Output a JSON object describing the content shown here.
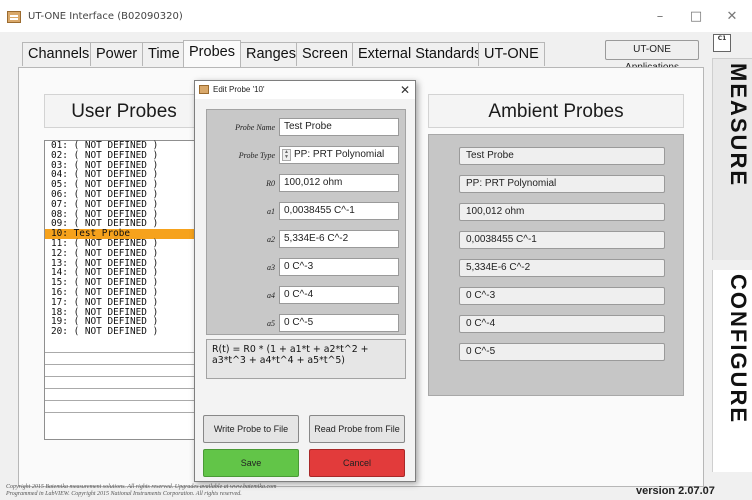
{
  "window": {
    "title": "UT-ONE Interface (B02090320)",
    "minimize_glyph": "–",
    "maximize_glyph": "□",
    "close_glyph": "✕"
  },
  "tabs": [
    {
      "label": "Channels",
      "active": false
    },
    {
      "label": "Power",
      "active": false
    },
    {
      "label": "Time",
      "active": false
    },
    {
      "label": "Probes",
      "active": true
    },
    {
      "label": "Ranges",
      "active": false
    },
    {
      "label": "Screen",
      "active": false
    },
    {
      "label": "External Standards",
      "active": false
    },
    {
      "label": "UT-ONE",
      "active": false
    }
  ],
  "apps_button": "UT-ONE Applications",
  "side_panel": {
    "ci_icon": "C1",
    "measure": "MEASURE",
    "configure": "CONFIGURE"
  },
  "user_probes": {
    "title": "User Probes",
    "items": [
      "01: ( NOT DEFINED )",
      "02: ( NOT DEFINED )",
      "03: ( NOT DEFINED )",
      "04: ( NOT DEFINED )",
      "05: ( NOT DEFINED )",
      "06: ( NOT DEFINED )",
      "07: ( NOT DEFINED )",
      "08: ( NOT DEFINED )",
      "09: ( NOT DEFINED )",
      "10: Test Probe",
      "11: ( NOT DEFINED )",
      "12: ( NOT DEFINED )",
      "13: ( NOT DEFINED )",
      "14: ( NOT DEFINED )",
      "15: ( NOT DEFINED )",
      "16: ( NOT DEFINED )",
      "17: ( NOT DEFINED )",
      "18: ( NOT DEFINED )",
      "19: ( NOT DEFINED )",
      "20: ( NOT DEFINED )"
    ],
    "selected_index": 9
  },
  "ambient_probes": {
    "title": "Ambient Probes",
    "fields": [
      "Test Probe",
      "PP: PRT Polynomial",
      "100,012 ohm",
      "0,0038455 C^-1",
      "5,334E-6 C^-2",
      "0 C^-3",
      "0 C^-4",
      "0 C^-5"
    ]
  },
  "dialog": {
    "title": "Edit Probe '10'",
    "close_glyph": "✕",
    "fields": [
      {
        "label": "Probe Name",
        "value": "Test Probe"
      },
      {
        "label": "Probe Type",
        "value": "PP: PRT Polynomial"
      },
      {
        "label": "R0",
        "value": "100,012 ohm"
      },
      {
        "label": "a1",
        "value": "0,0038455 C^-1"
      },
      {
        "label": "a2",
        "value": "5,334E-6 C^-2"
      },
      {
        "label": "a3",
        "value": "0 C^-3"
      },
      {
        "label": "a4",
        "value": "0 C^-4"
      },
      {
        "label": "a5",
        "value": "0 C^-5"
      }
    ],
    "formula": "R(t) = R0 * (1 + a1*t + a2*t^2 + a3*t^3 + a4*t^4 + a5*t^5)",
    "write_button": "Write Probe to File",
    "read_button": "Read Probe from File",
    "save_button": "Save",
    "cancel_button": "Cancel"
  },
  "footer": {
    "copyright_line1": "Copyright 2015 Batemika measurement solutions. All rights reserved. Upgrades available at www.batemika.com",
    "copyright_line2": "Programmed in LabVIEW. Copyright 2015 National Instruments Corporation. All rights reserved.",
    "version": "version 2.07.07"
  },
  "colors": {
    "selected_row": "#f6a21c",
    "save": "#62c548",
    "cancel": "#e23b3b"
  }
}
